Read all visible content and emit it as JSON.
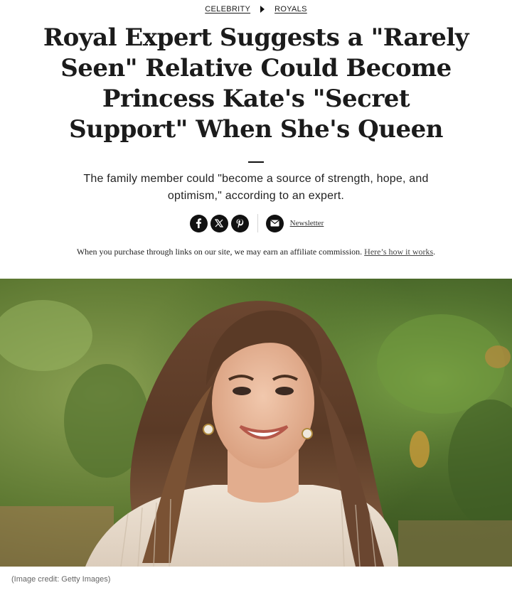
{
  "breadcrumb": {
    "items": [
      "CELEBRITY",
      "ROYALS"
    ]
  },
  "article": {
    "headline": "Royal Expert Suggests a \"Rarely Seen\" Relative Could Become Princess Kate's \"Secret Support\" When She's Queen",
    "dek": "The family member could \"become a source of strength, hope, and optimism,\" according to an expert."
  },
  "share": {
    "icons": [
      "facebook-icon",
      "x-icon",
      "pinterest-icon",
      "email-icon"
    ],
    "newsletter_label": "Newsletter"
  },
  "affiliate": {
    "text": "When you purchase through links on our site, we may earn an affiliate commission. ",
    "link": "Here’s how it works",
    "suffix": "."
  },
  "hero": {
    "credit": "(Image credit: Getty Images)"
  },
  "colors": {
    "text": "#1a1a1a",
    "icon_bg": "#111111",
    "credit": "#666666"
  }
}
